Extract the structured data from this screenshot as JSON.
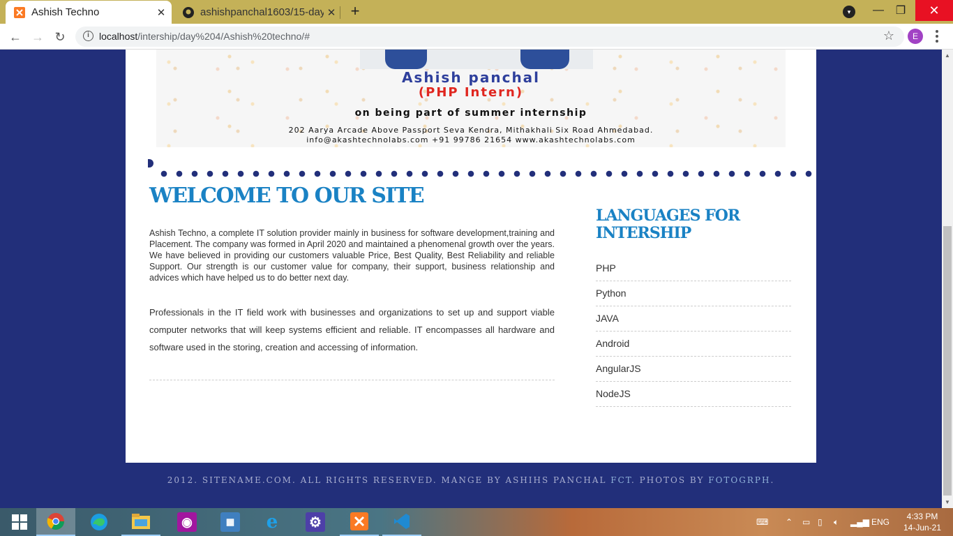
{
  "browser": {
    "tabs": [
      {
        "title": "Ashish Techno",
        "active": true
      },
      {
        "title": "ashishpanchal1603/15-day",
        "active": false
      }
    ],
    "new_tab": "+",
    "close_glyph": "✕",
    "url_host": "localhost",
    "url_path": "/intership/day%204/Ashish%20techno/#",
    "profile_initial": "E"
  },
  "banner": {
    "name": "Ashish panchal",
    "role": "(PHP Intern)",
    "tagline": "on being part of summer internship",
    "address": "202 Aarya Arcade Above Passport Seva Kendra, Mithakhali Six Road Ahmedabad.",
    "contact": "info@akashtechnolabs.com   +91 99786 21654   www.akashtechnolabs.com"
  },
  "main": {
    "heading": "WELCOME TO OUR SITE",
    "para1": "Ashish Techno, a complete IT solution provider mainly in business for software development,training and Placement. The company was formed in April 2020 and maintained a phenomenal growth over the years. We have believed in providing our customers valuable Price, Best Quality, Best Reliability and reliable Support. Our strength is our customer value for company, their support, business relationship and advices which have helped us to do better next day.",
    "para2": "Professionals in the IT field work with businesses and organizations to set up and support viable computer networks that will keep systems efficient and reliable. IT encompasses all hardware and software used in the storing, creation and accessing of information."
  },
  "sidebar": {
    "title": "LANGUAGES FOR INTERSHIP",
    "items": [
      "PHP",
      "Python",
      "JAVA",
      "Android",
      "AngularJS",
      "NodeJS"
    ]
  },
  "footer": {
    "text_a": "2012. SITENAME.COM. ALL RIGHTS RESERVED. MANGE BY ASHIHS PANCHAL ",
    "text_b": "FCT",
    "text_c": ". PHOTOS BY ",
    "text_d": "FOTOGRPH",
    "text_e": "."
  },
  "taskbar": {
    "apps": [
      "windows-start",
      "chrome",
      "edge",
      "file-explorer",
      "camera",
      "control-panel",
      "internet-explorer",
      "settings",
      "xampp",
      "vscode"
    ],
    "language": "ENG",
    "time": "4:33 PM",
    "date": "14-Jun-21"
  }
}
